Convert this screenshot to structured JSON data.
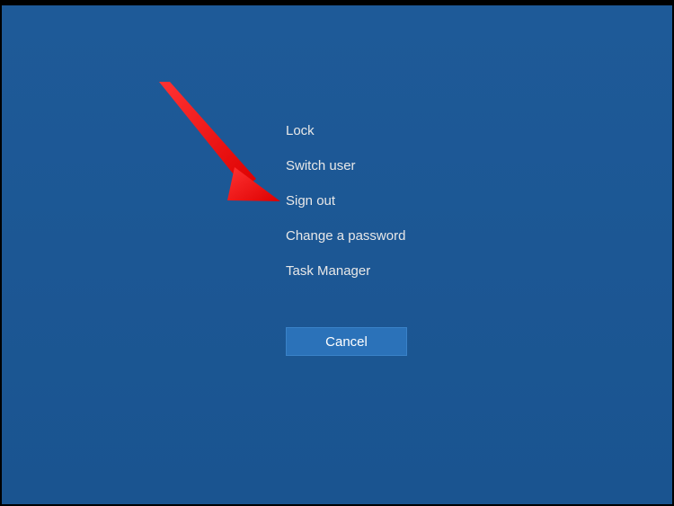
{
  "security_screen": {
    "options": [
      {
        "label": "Lock"
      },
      {
        "label": "Switch user"
      },
      {
        "label": "Sign out"
      },
      {
        "label": "Change a password"
      },
      {
        "label": "Task Manager"
      }
    ],
    "cancel_label": "Cancel"
  },
  "annotation": {
    "type": "arrow",
    "color": "#ff0000",
    "target": "sign-out"
  }
}
